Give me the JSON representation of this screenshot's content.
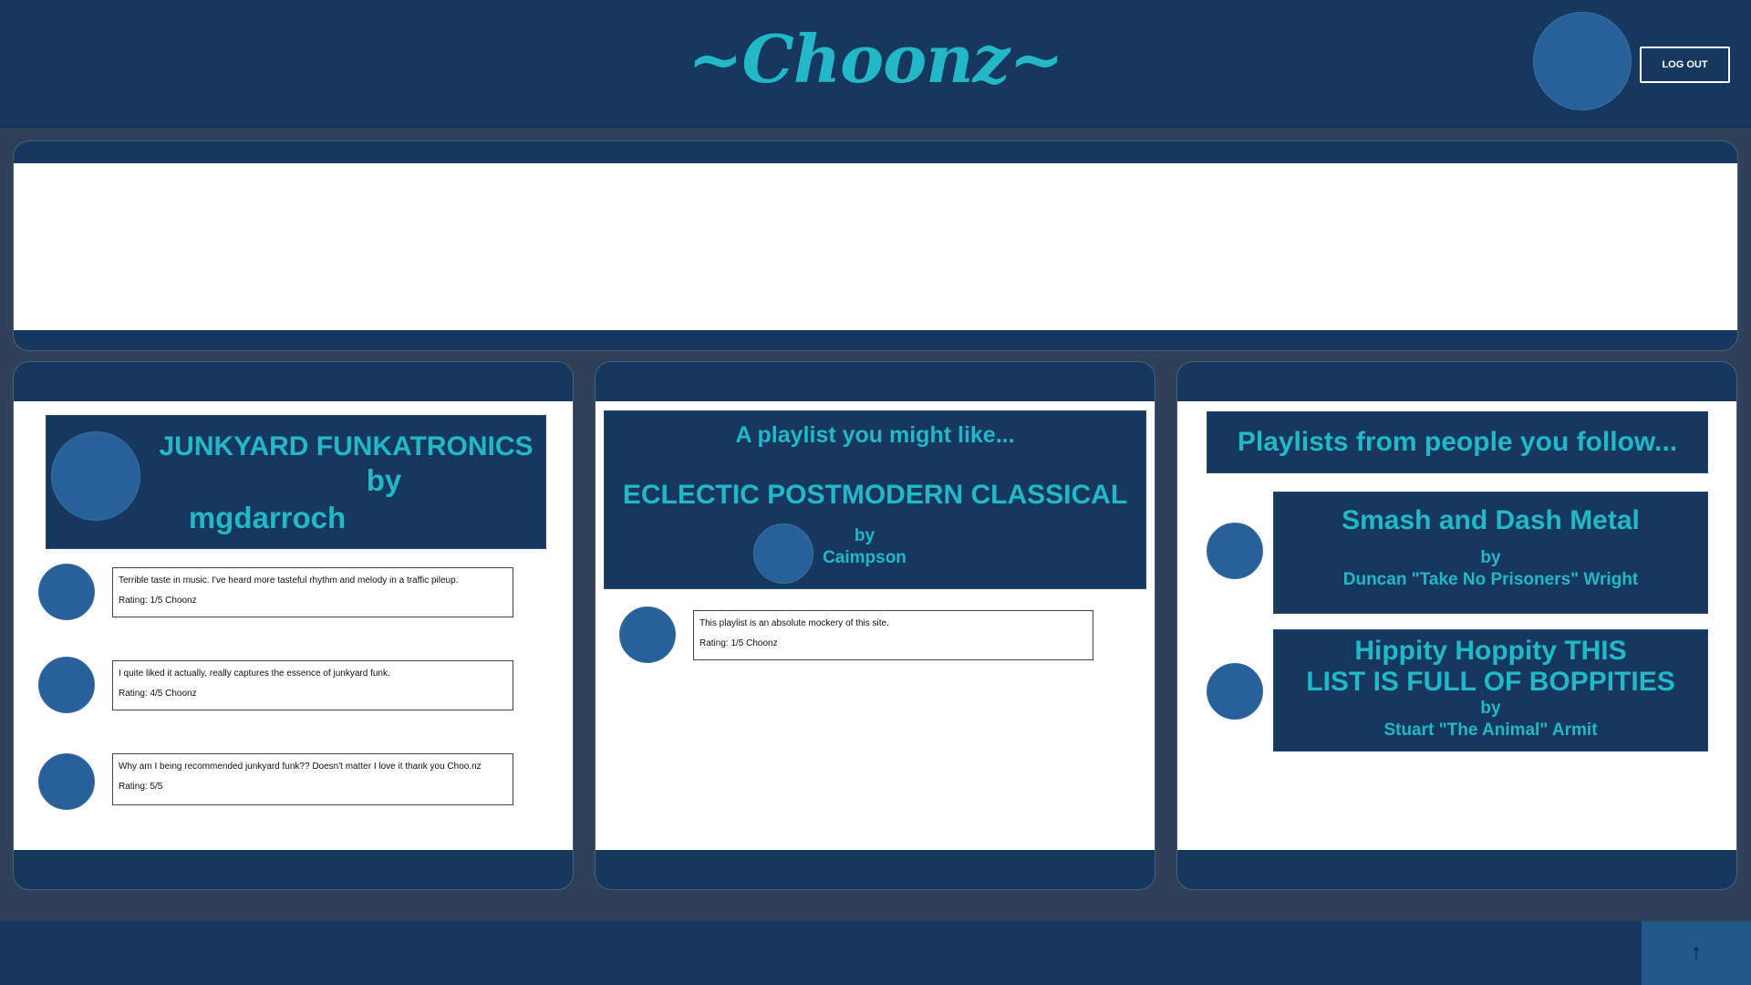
{
  "header": {
    "logo": "~Choonz~",
    "logout_label": "LOG OUT"
  },
  "playlist": {
    "title": "JUNKYARD FUNKATRONICS",
    "by": "by",
    "user": "mgdarroch",
    "comments": [
      {
        "text": "Terrible taste in music.  I've heard more tasteful rhythm and melody in a traffic pileup.",
        "rating": "Rating: 1/5 Choonz"
      },
      {
        "text": "I quite liked it actually, really captures the essence of junkyard funk.",
        "rating": "Rating: 4/5 Choonz"
      },
      {
        "text": "Why am I being recommended junkyard funk?? Doesn't matter I love it thank you Choo.nz",
        "rating": "Rating: 5/5"
      }
    ]
  },
  "recommended": {
    "subtitle": "A playlist you might like...",
    "title": "ECLECTIC POSTMODERN CLASSICAL",
    "by": "by",
    "user": "Caimpson",
    "comments": [
      {
        "text": "This playlist is an absolute mockery of this site.",
        "rating": "Rating: 1/5 Choonz"
      }
    ]
  },
  "following": {
    "heading": "Playlists from people you follow...",
    "playlists": [
      {
        "title": "Smash and Dash Metal",
        "by": "by",
        "user": "Duncan \"Take No Prisoners\" Wright"
      },
      {
        "title_line1": "Hippity Hoppity THIS",
        "title_line2": "LIST IS FULL OF BOPPITIES",
        "by": "by",
        "user": "Stuart \"The Animal\" Armit"
      }
    ]
  },
  "footer": {
    "scroll_top_icon": "arrow-up-icon",
    "scroll_top_glyph": "↑"
  }
}
